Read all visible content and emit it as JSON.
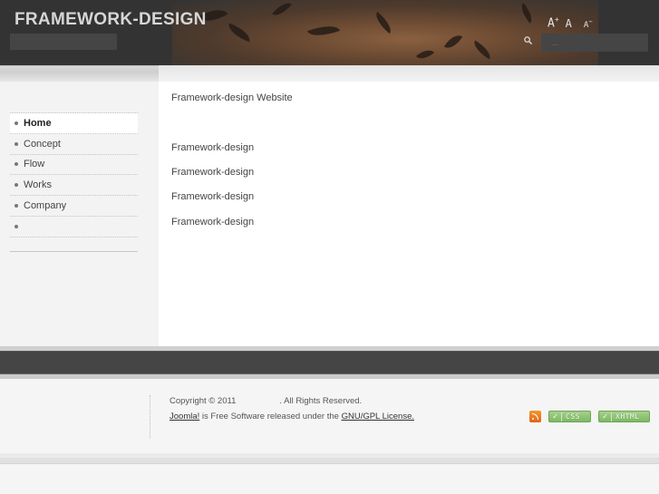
{
  "header": {
    "site_title": "FRAMEWORK-DESIGN",
    "font_tools": {
      "increase": "A",
      "increase_mark": "+",
      "reset": "A",
      "decrease": "A",
      "decrease_mark": "−"
    },
    "search": {
      "placeholder": "...",
      "icon": "search-icon"
    }
  },
  "sidebar": {
    "menu": [
      {
        "label": "Home",
        "active": true
      },
      {
        "label": "Concept",
        "active": false
      },
      {
        "label": "Flow",
        "active": false
      },
      {
        "label": "Works",
        "active": false
      },
      {
        "label": "Company",
        "active": false
      },
      {
        "label": "",
        "active": false
      }
    ]
  },
  "main": {
    "heading": "Framework-design Website",
    "items": [
      "Framework-design",
      "Framework-design",
      "Framework-design",
      "Framework-design"
    ]
  },
  "footer": {
    "copyright_prefix": "Copyright © 2011",
    "copyright_suffix": ". All Rights Reserved.",
    "joomla_link": "Joomla!",
    "license_middle": " is Free Software released under the ",
    "license_link": "GNU/GPL License.",
    "badges": {
      "rss": "rss-feed-icon",
      "css": "CSS",
      "xhtml": "XHTML",
      "check": "✓"
    }
  },
  "colors": {
    "header_bg": "#333333",
    "footer_bar": "#454545",
    "badge_green": "#7db864",
    "rss_orange": "#e0661a"
  }
}
